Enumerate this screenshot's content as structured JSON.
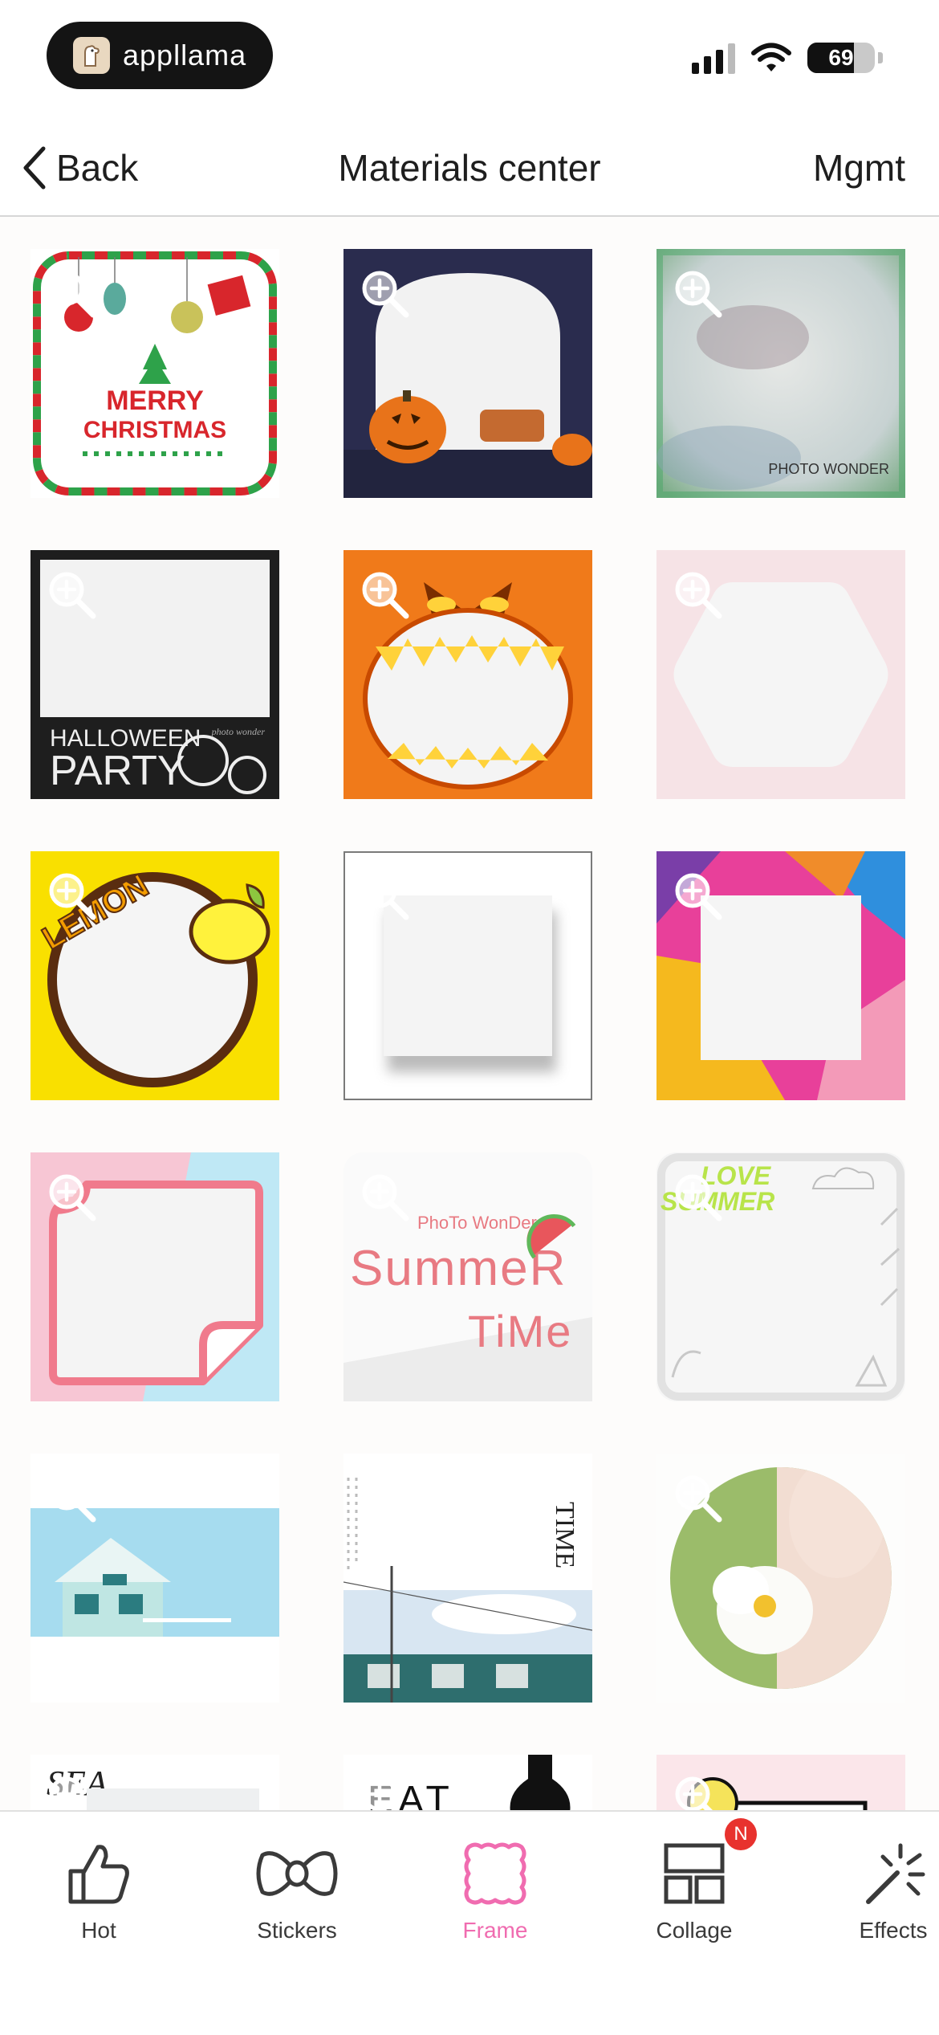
{
  "status_bar": {
    "brand": "appllama",
    "battery": "69"
  },
  "nav": {
    "back_label": "Back",
    "title": "Materials center",
    "manage_label": "Mgmt"
  },
  "frames": {
    "merry": "MERRY",
    "christmas": "CHRISTMAS",
    "photo_wonder": "PHOTO WONDER",
    "halloween": "HALLOWEEN",
    "party": "PARTY",
    "photo_wonder_small": "photo wonder",
    "lemon": "LEMON",
    "pw_script": "PhoTo WonDer",
    "summer": "SummeR",
    "time_script": "TiMe",
    "love": "LOVE",
    "summer_caps": "SUMMER",
    "time_caps": "TIME",
    "sea_partial": "SEA",
    "eat_partial": "EAT"
  },
  "tabs": [
    {
      "label": "Hot",
      "icon": "thumbs-up-icon"
    },
    {
      "label": "Stickers",
      "icon": "bow-icon"
    },
    {
      "label": "Frame",
      "icon": "frame-icon"
    },
    {
      "label": "Collage",
      "icon": "collage-icon",
      "badge": "N"
    },
    {
      "label": "Effects",
      "icon": "magic-wand-icon"
    }
  ],
  "colors": {
    "accent": "#f06cb0",
    "badge": "#e8322e"
  }
}
